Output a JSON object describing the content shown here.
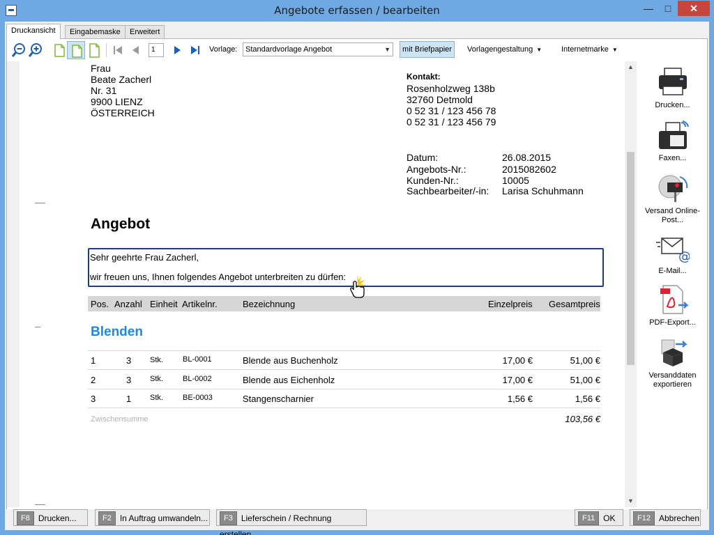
{
  "window": {
    "title": "Angebote erfassen / bearbeiten",
    "minimize": "—",
    "maximize": "□",
    "close": "✕"
  },
  "tabs": [
    {
      "label": "Druckansicht"
    },
    {
      "label": "Eingabemaske"
    },
    {
      "label": "Erweitert"
    }
  ],
  "toolbar": {
    "page_number": "1",
    "vorlage_label": "Vorlage:",
    "vorlage_value": "Standardvorlage Angebot",
    "briefpapier_label": "mit Briefpapier",
    "vorlagengestaltung_label": "Vorlagengestaltung",
    "internetmarke_label": "Internetmarke"
  },
  "document": {
    "recipient": [
      "Frau",
      "Beate Zacherl",
      "Nr. 31",
      "9900 LIENZ",
      "ÖSTERREICH"
    ],
    "contact_title": "Kontakt:",
    "contact_lines": [
      "Rosenholzweg 138b",
      "32760 Detmold",
      "0 52 31 / 123 456 78",
      "0 52 31 / 123 456 79"
    ],
    "meta": [
      {
        "label": "Datum:",
        "value": "26.08.2015"
      },
      {
        "label": "Angebots-Nr.:",
        "value": "2015082602"
      },
      {
        "label": "Kunden-Nr.:",
        "value": "10005"
      },
      {
        "label": "Sachbearbeiter/-in:",
        "value": "Larisa Schuhmann"
      }
    ],
    "heading": "Angebot",
    "salutation": "Sehr geehrte Frau Zacherl,",
    "intro": "wir freuen uns, Ihnen folgendes Angebot unterbreiten zu dürfen:",
    "columns": [
      "Pos.",
      "Anzahl",
      "Einheit",
      "Artikelnr.",
      "Bezeichnung",
      "Einzelpreis",
      "Gesamtpreis"
    ],
    "group_title": "Blenden",
    "rows": [
      {
        "pos": "1",
        "anzahl": "3",
        "einheit": "Stk.",
        "artikelnr": "BL-0001",
        "bezeichnung": "Blende aus Buchenholz",
        "einzelpreis": "17,00 €",
        "gesamtpreis": "51,00 €"
      },
      {
        "pos": "2",
        "anzahl": "3",
        "einheit": "Stk.",
        "artikelnr": "BL-0002",
        "bezeichnung": "Blende aus Eichenholz",
        "einzelpreis": "17,00 €",
        "gesamtpreis": "51,00 €"
      },
      {
        "pos": "3",
        "anzahl": "1",
        "einheit": "Stk.",
        "artikelnr": "BE-0003",
        "bezeichnung": "Stangenscharnier",
        "einzelpreis": "1,56 €",
        "gesamtpreis": "1,56 €"
      }
    ],
    "subtotal_label": "Zwischensumme",
    "subtotal_value": "103,56 €"
  },
  "actions": [
    {
      "label": "Drucken..."
    },
    {
      "label": "Faxen..."
    },
    {
      "label": "Versand Online-Post..."
    },
    {
      "label": "E-Mail..."
    },
    {
      "label": "PDF-Export..."
    },
    {
      "label": "Versanddaten exportieren"
    }
  ],
  "bottom": {
    "f8": {
      "key": "F8",
      "label": "Drucken..."
    },
    "f2": {
      "key": "F2",
      "label": "In Auftrag umwandeln..."
    },
    "f3": {
      "key": "F3",
      "label": "Lieferschein / Rechnung erstellen..."
    },
    "f11": {
      "key": "F11",
      "label": "OK"
    },
    "f12": {
      "key": "F12",
      "label": "Abbrechen"
    }
  },
  "colors": {
    "titlebar": "#6ea9e4",
    "group_title": "#1e88e5",
    "briefpapier_btn": "#cde4f7",
    "close_btn": "#c7463c"
  }
}
